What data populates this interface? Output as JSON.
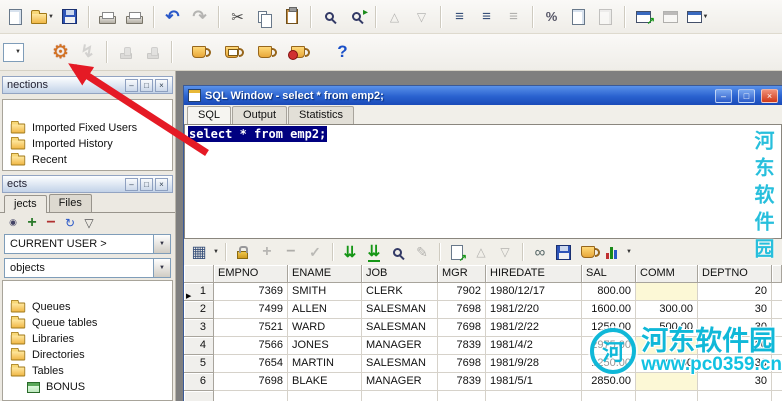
{
  "toolbar_main": {
    "icon_names": [
      "new",
      "open",
      "save",
      "print",
      "print-preview",
      "undo",
      "redo",
      "cut",
      "copy",
      "paste",
      "find",
      "find-next",
      "prev-item",
      "next-item",
      "list",
      "indent",
      "outdent",
      "percent",
      "compare",
      "compare-alt",
      "new-window",
      "window",
      "cascade-window"
    ]
  },
  "toolbar_session": {
    "icon_names": [
      "mode-select",
      "preferences",
      "execute",
      "stamp",
      "stamp-alt",
      "session",
      "sql-session",
      "session-alt",
      "commit-session",
      "help"
    ]
  },
  "left": {
    "connections": {
      "title": "nections",
      "items": [
        {
          "label": "Imported Fixed Users"
        },
        {
          "label": "Imported History"
        },
        {
          "label": "Recent"
        }
      ]
    },
    "objects": {
      "title": "ects",
      "tabs": [
        {
          "label": "jects"
        },
        {
          "label": "Files"
        }
      ],
      "user_filter": "CURRENT USER >",
      "object_filter": "objects",
      "tree": [
        {
          "label": "Queues"
        },
        {
          "label": "Queue tables"
        },
        {
          "label": "Libraries"
        },
        {
          "label": "Directories"
        },
        {
          "label": "Tables"
        },
        {
          "label": "BONUS"
        }
      ]
    }
  },
  "sql_window": {
    "title": "SQL Window - select * from emp2;",
    "tabs": [
      {
        "label": "SQL"
      },
      {
        "label": "Output"
      },
      {
        "label": "Statistics"
      }
    ],
    "editor_text": "select * from emp2;",
    "grid_toolbar_icon_names": [
      "grid-view",
      "lock",
      "insert-record",
      "delete-record",
      "post",
      "fetch-next",
      "fetch-all",
      "find",
      "edit",
      "export",
      "sort-asc",
      "sort-desc",
      "link",
      "save",
      "export-alt",
      "chart"
    ],
    "grid": {
      "columns": [
        "EMPNO",
        "ENAME",
        "JOB",
        "MGR",
        "HIREDATE",
        "SAL",
        "COMM",
        "DEPTNO"
      ],
      "rows": [
        {
          "n": "1",
          "empno": "7369",
          "ename": "SMITH",
          "job": "CLERK",
          "mgr": "7902",
          "hiredate": "1980/12/17",
          "sal": "800.00",
          "comm": "",
          "deptno": "20"
        },
        {
          "n": "2",
          "empno": "7499",
          "ename": "ALLEN",
          "job": "SALESMAN",
          "mgr": "7698",
          "hiredate": "1981/2/20",
          "sal": "1600.00",
          "comm": "300.00",
          "deptno": "30"
        },
        {
          "n": "3",
          "empno": "7521",
          "ename": "WARD",
          "job": "SALESMAN",
          "mgr": "7698",
          "hiredate": "1981/2/22",
          "sal": "1250.00",
          "comm": "500.00",
          "deptno": "30"
        },
        {
          "n": "4",
          "empno": "7566",
          "ename": "JONES",
          "job": "MANAGER",
          "mgr": "7839",
          "hiredate": "1981/4/2",
          "sal": "2975.00",
          "comm": "",
          "deptno": "20"
        },
        {
          "n": "5",
          "empno": "7654",
          "ename": "MARTIN",
          "job": "SALESMAN",
          "mgr": "7698",
          "hiredate": "1981/9/28",
          "sal": "1250.00",
          "comm": "1400.00",
          "deptno": "30"
        },
        {
          "n": "6",
          "empno": "7698",
          "ename": "BLAKE",
          "job": "MANAGER",
          "mgr": "7839",
          "hiredate": "1981/5/1",
          "sal": "2850.00",
          "comm": "",
          "deptno": "30"
        }
      ]
    }
  },
  "watermark": {
    "vertical_text": "河东软件园",
    "site_name": "河东软件园",
    "site_url": "www.pc0359.cn",
    "logo_text": "河"
  },
  "colors": {
    "titlebar_blue": "#2a62cf",
    "selection_navy": "#000080",
    "watermark_cyan": "#10b8d8",
    "arrow_red": "#e51a25",
    "null_cell": "#fcf8d6",
    "mdi_gray": "#7f7f7f"
  }
}
